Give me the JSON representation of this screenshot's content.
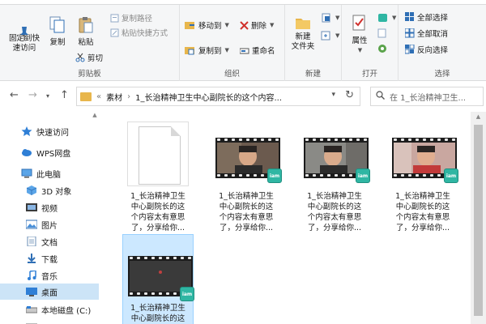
{
  "ribbon": {
    "clipboard": {
      "pin_label": "固定到快\n速访问",
      "copy_label": "复制",
      "paste_label": "粘贴",
      "copy_path": "复制路径",
      "paste_shortcut": "粘贴快捷方式",
      "cut": "剪切",
      "group_label": "剪贴板"
    },
    "organize": {
      "move_to": "移动到",
      "copy_to": "复制到",
      "delete": "删除",
      "rename": "重命名",
      "group_label": "组织"
    },
    "new": {
      "new_folder": "新建\n文件夹",
      "group_label": "新建"
    },
    "open": {
      "properties": "属性",
      "group_label": "打开"
    },
    "select": {
      "select_all": "全部选择",
      "select_none": "全部取消",
      "invert": "反向选择",
      "group_label": "选择"
    }
  },
  "address": {
    "overflow": "«",
    "crumb1": "素材",
    "crumb2": "1_长治精神卫生中心副院长的这个内容...",
    "search_placeholder": "在 1_长治精神卫生..."
  },
  "nav": {
    "items": [
      {
        "label": "快速访问"
      },
      {
        "label": "WPS网盘"
      },
      {
        "label": "此电脑"
      },
      {
        "label": "3D 对象"
      },
      {
        "label": "视频"
      },
      {
        "label": "图片"
      },
      {
        "label": "文档"
      },
      {
        "label": "下载"
      },
      {
        "label": "音乐"
      },
      {
        "label": "桌面"
      },
      {
        "label": "本地磁盘 (C:)"
      }
    ]
  },
  "files": [
    {
      "line1": "1_长治精神卫生",
      "line2": "中心副院长的这",
      "line3": "个内容太有意思",
      "line4": "了，分享给你..."
    },
    {
      "line1": "1_长治精神卫生",
      "line2": "中心副院长的这",
      "line3": "个内容太有意思",
      "line4": "了，分享给你..."
    },
    {
      "line1": "1_长治精神卫生",
      "line2": "中心副院长的这",
      "line3": "个内容太有意思",
      "line4": "了，分享给你..."
    },
    {
      "line1": "1_长治精神卫生",
      "line2": "中心副院长的这",
      "line3": "个内容太有意思",
      "line4": "了，分享给你..."
    },
    {
      "line1": "1_长治精神卫生",
      "line2": "中心副院长的这",
      "line3": "",
      "line4": ""
    }
  ],
  "badge_text": "iam",
  "colors": {
    "accent": "#0078d7",
    "selection": "#cce8ff",
    "badge": "#2fb6a3",
    "folder": "#e8b64c"
  }
}
